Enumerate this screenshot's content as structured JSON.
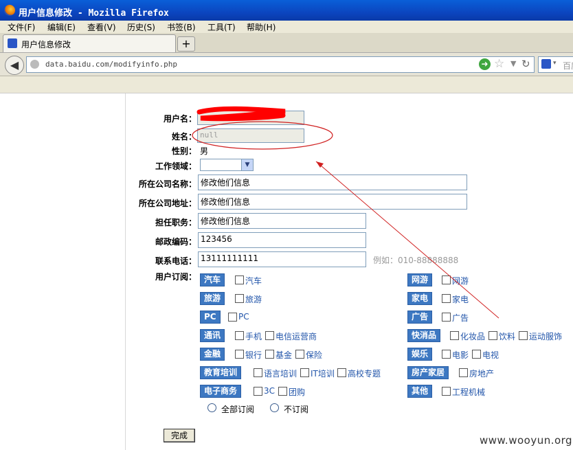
{
  "window": {
    "title": "用户信息修改 - Mozilla Firefox"
  },
  "menu": [
    "文件(F)",
    "编辑(E)",
    "查看(V)",
    "历史(S)",
    "书签(B)",
    "工具(T)",
    "帮助(H)"
  ],
  "tab": {
    "label": "用户信息修改",
    "new_tab": "+"
  },
  "nav": {
    "url": "data.baidu.com/modifyinfo.php",
    "search_text": "百度"
  },
  "form": {
    "username_label": "用户名：",
    "name_label": "姓名：",
    "name_value": "null",
    "gender_label": "性别：",
    "gender_value": "男",
    "field_label": "工作领域：",
    "company_label": "所在公司名称：",
    "company_value": "修改他们信息",
    "address_label": "所在公司地址：",
    "address_value": "修改他们信息",
    "position_label": "担任职务：",
    "position_value": "修改他们信息",
    "zip_label": "邮政编码：",
    "zip_value": "123456",
    "phone_label": "联系电话：",
    "phone_value": "13111111111",
    "phone_hint": "例如：010-88888888",
    "subscribe_label": "用户订阅："
  },
  "subscriptions": {
    "left": [
      {
        "cat": "汽车",
        "opts": [
          "汽车"
        ]
      },
      {
        "cat": "旅游",
        "opts": [
          "旅游"
        ]
      },
      {
        "cat": "PC",
        "opts": [
          "PC"
        ]
      },
      {
        "cat": "通讯",
        "opts": [
          "手机",
          "电信运营商"
        ]
      },
      {
        "cat": "金融",
        "opts": [
          "银行",
          "基金",
          "保险"
        ]
      },
      {
        "cat": "教育培训",
        "opts": [
          "语言培训",
          "IT培训",
          "高校专题"
        ]
      },
      {
        "cat": "电子商务",
        "opts": [
          "3C",
          "团购"
        ]
      }
    ],
    "right": [
      {
        "cat": "网游",
        "opts": [
          "网游"
        ]
      },
      {
        "cat": "家电",
        "opts": [
          "家电"
        ]
      },
      {
        "cat": "广告",
        "opts": [
          "广告"
        ]
      },
      {
        "cat": "快消品",
        "opts": [
          "化妆品",
          "饮料",
          "运动服饰"
        ]
      },
      {
        "cat": "娱乐",
        "opts": [
          "电影",
          "电视"
        ]
      },
      {
        "cat": "房产家居",
        "opts": [
          "房地产"
        ]
      },
      {
        "cat": "其他",
        "opts": [
          "工程机械"
        ]
      }
    ],
    "radio_all": "全部订阅",
    "radio_none": "不订阅"
  },
  "submit": "完成",
  "watermark": "www.wooyun.org"
}
